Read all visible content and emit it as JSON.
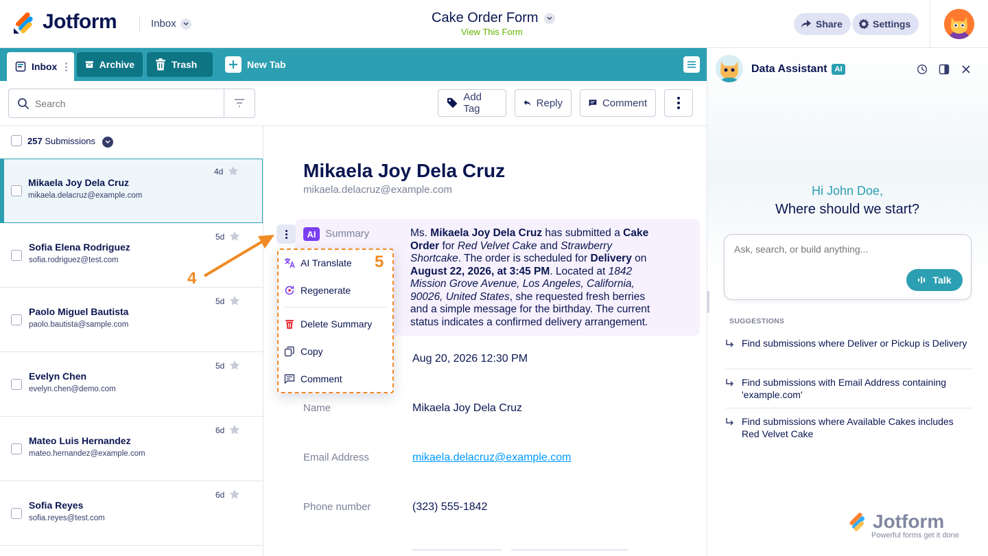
{
  "header": {
    "logo": "Jotform",
    "inbox_label": "Inbox",
    "form_title": "Cake Order Form",
    "view_form": "View This Form",
    "share": "Share",
    "settings": "Settings"
  },
  "tabs": {
    "inbox": "Inbox",
    "archive": "Archive",
    "trash": "Trash",
    "new_tab": "New Tab"
  },
  "search": {
    "placeholder": "Search"
  },
  "toolbar": {
    "add_tag": "Add Tag",
    "reply": "Reply",
    "comment": "Comment"
  },
  "submissions": {
    "count": "257",
    "label": "Submissions",
    "items": [
      {
        "name": "Mikaela Joy Dela Cruz",
        "email": "mikaela.delacruz@example.com",
        "age": "4d"
      },
      {
        "name": "Sofia Elena Rodriguez",
        "email": "sofia.rodriguez@test.com",
        "age": "5d"
      },
      {
        "name": "Paolo Miguel Bautista",
        "email": "paolo.bautista@sample.com",
        "age": "5d"
      },
      {
        "name": "Evelyn Chen",
        "email": "evelyn.chen@demo.com",
        "age": "5d"
      },
      {
        "name": "Mateo Luis Hernandez",
        "email": "mateo.hernandez@example.com",
        "age": "6d"
      },
      {
        "name": "Sofia Reyes",
        "email": "sofia.reyes@test.com",
        "age": "6d"
      }
    ]
  },
  "detail": {
    "name": "Mikaela Joy Dela Cruz",
    "email": "mikaela.delacruz@example.com",
    "ai_badge": "AI",
    "summary_label": "Summary",
    "date_value": "Aug 20, 2026 12:30 PM",
    "fields": [
      {
        "label": "Name",
        "value": "Mikaela Joy Dela Cruz"
      },
      {
        "label": "Email Address",
        "value": "mikaela.delacruz@example.com"
      },
      {
        "label": "Phone number",
        "value": "(323) 555-1842"
      }
    ]
  },
  "summary_menu": {
    "ai_translate": "AI Translate",
    "regenerate": "Regenerate",
    "delete_summary": "Delete Summary",
    "copy": "Copy",
    "comment": "Comment"
  },
  "annotations": {
    "step4": "4",
    "step5": "5"
  },
  "assistant": {
    "title": "Data Assistant",
    "badge": "AI",
    "greeting": "Hi John Doe,",
    "prompt": "Where should we start?",
    "input_placeholder": "Ask, search, or build anything...",
    "talk": "Talk",
    "suggestions_label": "SUGGESTIONS",
    "suggestions": [
      "Find submissions where Deliver or Pickup is Delivery",
      "Find submissions with Email Address containing 'example.com'",
      "Find submissions where Available Cakes includes Red Velvet Cake"
    ],
    "watermark_title": "Jotform",
    "watermark_sub": "Powerful forms get it done"
  },
  "colors": {
    "teal": "#2d9fb2",
    "navy": "#0a1551",
    "orange": "#f08a24",
    "ai_purple": "#7b3ef2"
  }
}
